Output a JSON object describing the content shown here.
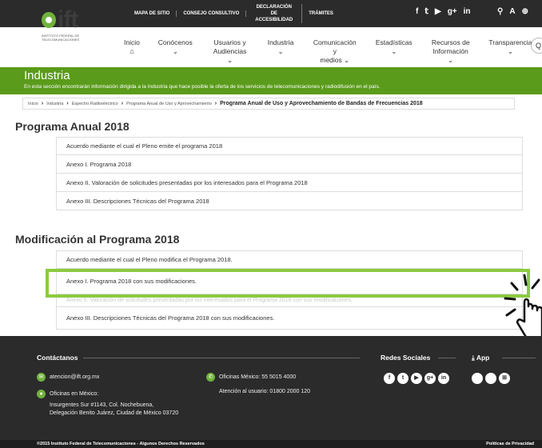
{
  "topbar": {
    "links": [
      "MAPA DE SITIO",
      "CONSEJO CONSULTIVO",
      "DECLARACIÓN DE ACCESIBILIDAD",
      "TRÁMITES"
    ],
    "social": [
      "f",
      "t",
      "yt",
      "g+",
      "in"
    ],
    "tools": [
      "search-icon",
      "A",
      "zoom-icon"
    ],
    "tool_text": "A"
  },
  "logo": {
    "name": "ift",
    "subtitle": "INSTITUTO FEDERAL DE TELECOMUNICACIONES"
  },
  "nav": {
    "items": [
      {
        "label": "Inicio",
        "sub": "⌂"
      },
      {
        "label": "Conócenos ⌄",
        "sub": ""
      },
      {
        "label": "Usuarios y",
        "sub": "Audiencias ⌄"
      },
      {
        "label": "Industria ⌄",
        "sub": ""
      },
      {
        "label": "Comunicación y",
        "sub": "medios ⌄"
      },
      {
        "label": "Estadísticas ⌄",
        "sub": ""
      },
      {
        "label": "Recursos de",
        "sub": "Información ⌄"
      },
      {
        "label": "Transparencia ⌄",
        "sub": ""
      }
    ]
  },
  "banner": {
    "title": "Industria",
    "text": "En esta sección encontrarán información dirigida a la Industria que hace posible la oferta de los servicios de telecomunicaciones y radiodifusión en el país."
  },
  "breadcrumb": {
    "items": [
      "Inicio",
      "Industria",
      "Espectro Radioeléctrico",
      "Programa Anual de Uso y Aprovechamiento"
    ],
    "current": "Programa Anual de Uso y Aprovechamiento de Bandas de Frecuencias 2018"
  },
  "section1": {
    "title": "Programa Anual 2018",
    "rows": [
      "Acuerdo mediante el cual el Pleno emite el programa 2018",
      "Anexo I. Programa 2018",
      "Anexo II. Valoración de solicitudes presentadas por los interesados para el Programa 2018",
      "Anexo III. Descripciones Técnicas del Programa 2018"
    ]
  },
  "section2": {
    "title": "Modificación al Programa 2018",
    "rows": [
      "Acuerdo mediante el cual el Pleno modifica el Programa 2018.",
      "Anexo I. Programa 2018 con sus modificaciones.",
      "Anexo II. Valoración de solicitudes presentadas por los interesados para el Programa 2018 con sus modificaciones.",
      "Anexo III. Descripciones Técnicas del Programa 2018 con sus modificaciones."
    ]
  },
  "footer": {
    "contact_title": "Contáctanos",
    "email": "atencion@ift.org.mx",
    "offices_label": "Oficinas en México:",
    "address_1": "Insurgentes Sur #1143, Col. Nochebuena,",
    "address_2": "Delegación Benito Juárez, Ciudad de México 03720",
    "phone": "Oficinas México: 55 5015 4000",
    "attention": "Atención al usuario: 01800 2000 120",
    "social_title": "Redes Sociales",
    "social_icons": [
      "f",
      "t",
      "▶",
      "g+",
      "in"
    ],
    "app_title": "App",
    "app_icons": [
      "",
      "",
      "⊞"
    ],
    "copyright": "©2015 Instituto Federal de Telecomunicaciones - Algunos Derechos Reservados",
    "privacy": "Políticas de Privacidad"
  },
  "colors": {
    "brand_green": "#5b9b1b",
    "highlight": "#8ccb3f",
    "dark": "#2b2b2b"
  }
}
